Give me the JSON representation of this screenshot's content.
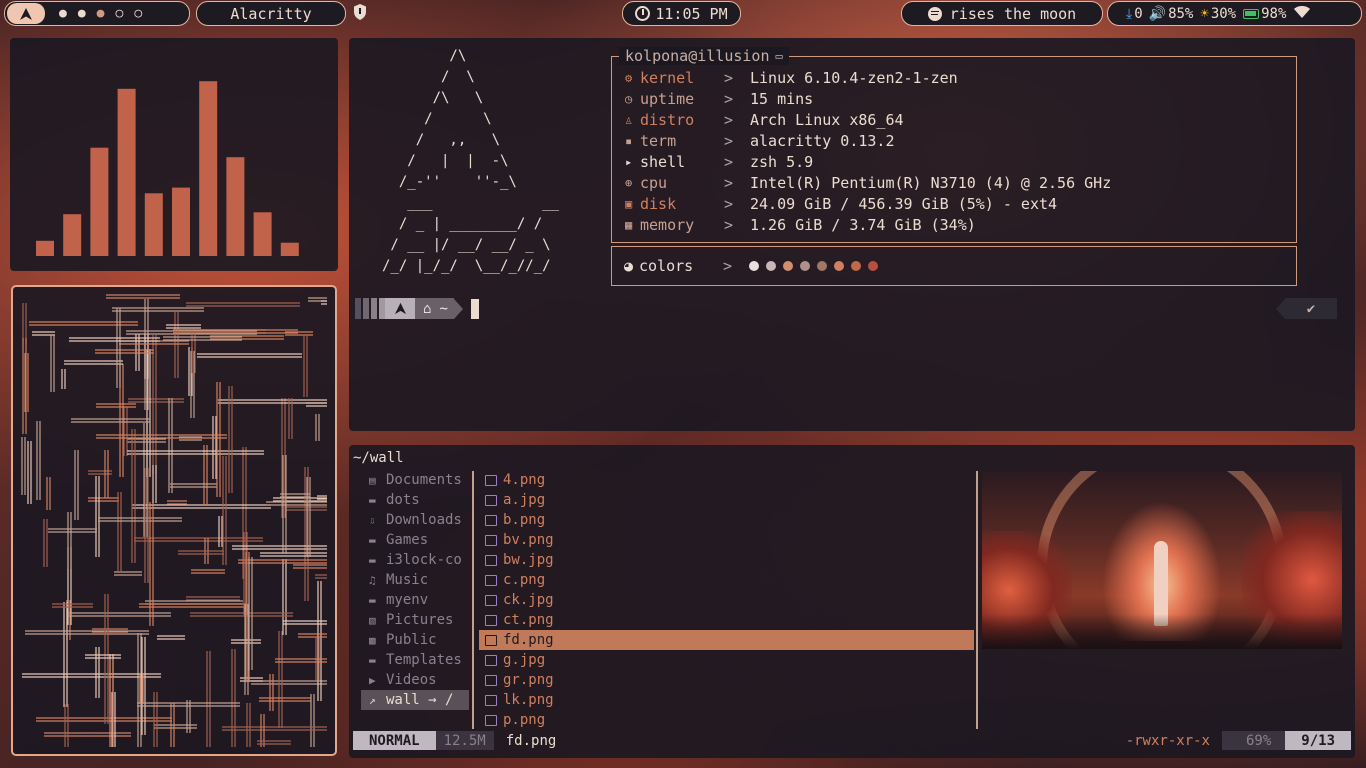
{
  "topbar": {
    "workspaces": [
      "●",
      "●",
      "●",
      "○",
      "○"
    ],
    "window_title": "Alacritty",
    "clock": "11:05 PM",
    "music": "rises the moon",
    "downloads": "0",
    "volume": "85%",
    "brightness": "30%",
    "battery": "98%"
  },
  "visualizer": {
    "levels": [
      0.08,
      0.22,
      0.57,
      0.88,
      0.33,
      0.36,
      0.92,
      0.52,
      0.23,
      0.07
    ]
  },
  "neofetch": {
    "ascii": "        /\\\n       /  \\\n      /\\   \\\n     /      \\\n    /   ,,   \\\n   /   |  |  -\\\n  /_-''    ''-_\\\n   ___             __\n  / _ | ________/ /\n / __ |/ __/ __/ _ \\\n/_/ |_/_/  \\__/_//_/",
    "header": "kolpona@illusion",
    "rows": [
      {
        "icon": "⚙",
        "key": "kernel",
        "val": "Linux 6.10.4-zen2-1-zen",
        "color": "#d08060"
      },
      {
        "icon": "◷",
        "key": "uptime",
        "val": "15 mins",
        "color": "#c8a090"
      },
      {
        "icon": "♙",
        "key": "distro",
        "val": "Arch Linux x86_64",
        "color": "#d08060"
      },
      {
        "icon": "▪",
        "key": "term",
        "val": "alacritty 0.13.2",
        "color": "#c8a090"
      },
      {
        "icon": "▸",
        "key": "shell",
        "val": "zsh 5.9",
        "color": "#e8dcd3"
      },
      {
        "icon": "⊕",
        "key": "cpu",
        "val": "Intel(R) Pentium(R)  N3710 (4) @ 2.56 GHz",
        "color": "#c8a090"
      },
      {
        "icon": "▣",
        "key": "disk",
        "val": "24.09 GiB / 456.39 GiB (5%) - ext4",
        "color": "#d08060"
      },
      {
        "icon": "▦",
        "key": "memory",
        "val": "1.26 GiB / 3.74 GiB (34%)",
        "color": "#c8a090"
      }
    ],
    "sep": ">",
    "colors_label": "colors",
    "palette": [
      "#e8e0e0",
      "#c8b8b8",
      "#d09070",
      "#b09088",
      "#a07868",
      "#d08060",
      "#c06848",
      "#b85040"
    ]
  },
  "prompt": {
    "home": "~",
    "status": "✔"
  },
  "files": {
    "path": "~/wall",
    "parent": [
      {
        "icon": "▤",
        "name": "Documents"
      },
      {
        "icon": "▬",
        "name": "dots"
      },
      {
        "icon": "⇩",
        "name": "Downloads"
      },
      {
        "icon": "▬",
        "name": "Games"
      },
      {
        "icon": "▬",
        "name": "i3lock-co"
      },
      {
        "icon": "♫",
        "name": "Music"
      },
      {
        "icon": "▬",
        "name": "myenv"
      },
      {
        "icon": "▧",
        "name": "Pictures"
      },
      {
        "icon": "▩",
        "name": "Public"
      },
      {
        "icon": "▬",
        "name": "Templates"
      },
      {
        "icon": "▶",
        "name": "Videos"
      },
      {
        "icon": "↗",
        "name": "wall → /"
      }
    ],
    "current": [
      "4.png",
      "a.jpg",
      "b.png",
      "bv.png",
      "bw.jpg",
      "c.png",
      "ck.jpg",
      "ct.png",
      "fd.png",
      "g.jpg",
      "gr.png",
      "lk.png",
      "p.png"
    ],
    "selected_index": 8
  },
  "statusline": {
    "mode": "NORMAL",
    "size": "12.5M",
    "file": "fd.png",
    "perms": "-rwxr-xr-x",
    "percent": "69%",
    "pos": "9/13"
  }
}
